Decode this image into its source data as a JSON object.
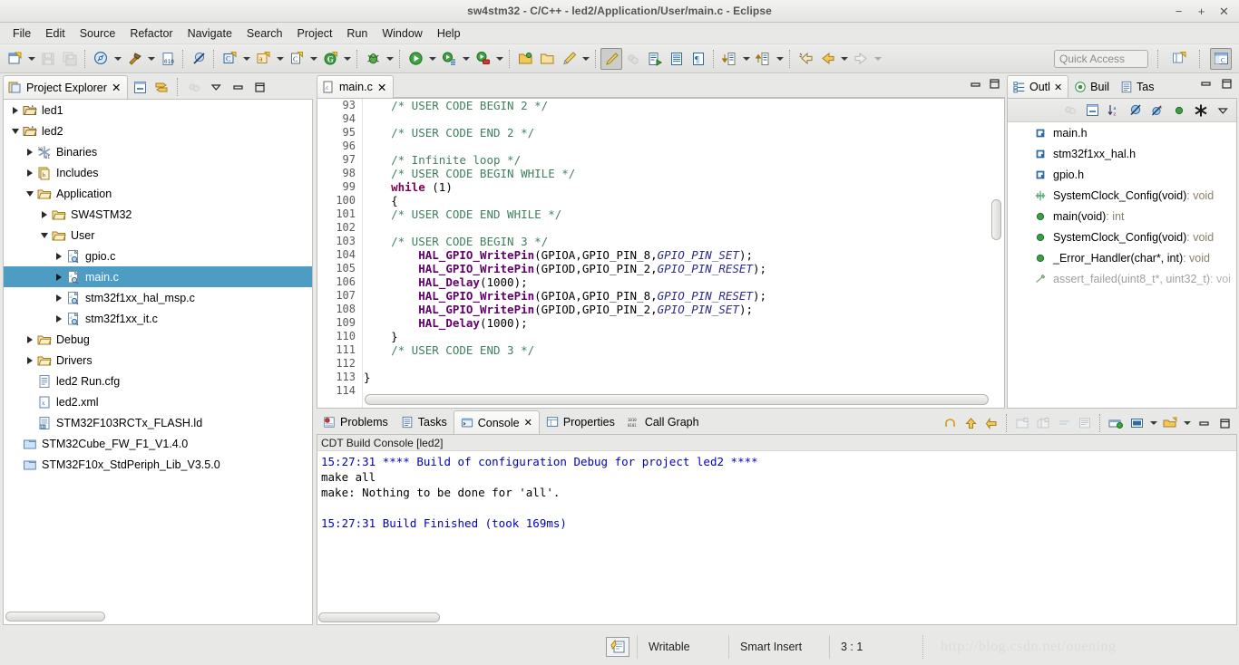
{
  "window": {
    "title": "sw4stm32 - C/C++ - led2/Application/User/main.c - Eclipse",
    "minimize": "−",
    "maximize": "+",
    "close": "✕"
  },
  "menubar": {
    "items": [
      "File",
      "Edit",
      "Source",
      "Refactor",
      "Navigate",
      "Search",
      "Project",
      "Run",
      "Window",
      "Help"
    ]
  },
  "toolbar": {
    "quick_access": "Quick Access",
    "icons": [
      "new-file-icon",
      "new-dropdown",
      "save-icon",
      "save-all-icon",
      "sep1",
      "build-all-icon",
      "build-dropdown",
      "build-hammer-icon",
      "hammer-dropdown",
      "binary-010-icon",
      "sep2",
      "no-tool-icon",
      "sep3",
      "new-c-project-icon",
      "c-dropdown",
      "new-c-class-icon",
      "class-dropdown",
      "new-c-source-icon",
      "source-dropdown",
      "git-icon",
      "git-dropdown",
      "sep4",
      "debug-icon",
      "debug-dropdown",
      "sep5",
      "run-icon",
      "run-dropdown",
      "run-config-icon",
      "runconfig-dropdown",
      "run-stop-icon",
      "stop-dropdown",
      "sep6",
      "open-resource-icon",
      "open-folder-icon",
      "highlight-pen-icon",
      "pen-dropdown",
      "sep7",
      "toggle-mark-occurrences-icon",
      "skip-breakpoints-icon",
      "next-edit-icon",
      "show-whitespace-icon",
      "pilcrow-icon",
      "sep8",
      "next-annotation-icon",
      "next-dropdown",
      "prev-annotation-icon",
      "prev-dropdown",
      "sep9",
      "last-edit-location-icon",
      "back-icon",
      "back-dropdown",
      "forward-icon",
      "forward-dropdown"
    ],
    "right_icons": [
      "new-perspective-icon",
      "cpp-perspective-icon"
    ]
  },
  "project_explorer": {
    "tab_label": "Project Explorer",
    "close_glyph": "✕",
    "toolbar_icons": [
      "collapse-all-icon",
      "link-with-editor-icon",
      "focus-on-active-task-icon",
      "view-menu-icon",
      "minimize-icon",
      "maximize-icon"
    ],
    "tree": [
      {
        "label": "led1",
        "indent": 0,
        "state": "closed",
        "icon": "project-closed-icon",
        "selected": false
      },
      {
        "label": "led2",
        "indent": 0,
        "state": "open",
        "icon": "project-open-icon",
        "selected": false
      },
      {
        "label": "Binaries",
        "indent": 1,
        "state": "closed",
        "icon": "binaries-icon",
        "selected": false
      },
      {
        "label": "Includes",
        "indent": 1,
        "state": "closed",
        "icon": "includes-icon",
        "selected": false
      },
      {
        "label": "Application",
        "indent": 1,
        "state": "open",
        "icon": "folder-icon",
        "selected": false
      },
      {
        "label": "SW4STM32",
        "indent": 2,
        "state": "closed",
        "icon": "folder-icon",
        "selected": false
      },
      {
        "label": "User",
        "indent": 2,
        "state": "open",
        "icon": "folder-icon",
        "selected": false
      },
      {
        "label": "gpio.c",
        "indent": 3,
        "state": "closed",
        "icon": "c-file-icon",
        "selected": false
      },
      {
        "label": "main.c",
        "indent": 3,
        "state": "closed",
        "icon": "c-file-icon",
        "selected": true
      },
      {
        "label": "stm32f1xx_hal_msp.c",
        "indent": 3,
        "state": "closed",
        "icon": "c-file-icon",
        "selected": false
      },
      {
        "label": "stm32f1xx_it.c",
        "indent": 3,
        "state": "closed",
        "icon": "c-file-icon",
        "selected": false
      },
      {
        "label": "Debug",
        "indent": 1,
        "state": "closed",
        "icon": "folder-icon",
        "selected": false
      },
      {
        "label": "Drivers",
        "indent": 1,
        "state": "closed",
        "icon": "folder-icon",
        "selected": false
      },
      {
        "label": "led2 Run.cfg",
        "indent": 1,
        "state": "none",
        "icon": "text-file-icon",
        "selected": false
      },
      {
        "label": "led2.xml",
        "indent": 1,
        "state": "none",
        "icon": "xml-file-icon",
        "selected": false
      },
      {
        "label": "STM32F103RCTx_FLASH.ld",
        "indent": 1,
        "state": "none",
        "icon": "linker-file-icon",
        "selected": false
      },
      {
        "label": "STM32Cube_FW_F1_V1.4.0",
        "indent": 0,
        "state": "none",
        "icon": "closed-project-icon",
        "selected": false
      },
      {
        "label": "STM32F10x_StdPeriph_Lib_V3.5.0",
        "indent": 0,
        "state": "none",
        "icon": "closed-project-icon",
        "selected": false
      }
    ]
  },
  "editor": {
    "tab_label": "main.c",
    "tab_icon": "c-source-icon",
    "close_glyph": "✕",
    "minimize_icon": "minimize-icon",
    "maximize_icon": "maximize-icon",
    "first_line": 93,
    "lines": [
      {
        "n": 93,
        "segments": [
          {
            "t": "    /* USER CODE BEGIN 2 */",
            "c": "cmt"
          }
        ]
      },
      {
        "n": 94,
        "segments": [
          {
            "t": "",
            "c": ""
          }
        ]
      },
      {
        "n": 95,
        "segments": [
          {
            "t": "    /* USER CODE END 2 */",
            "c": "cmt"
          }
        ]
      },
      {
        "n": 96,
        "segments": [
          {
            "t": "",
            "c": ""
          }
        ]
      },
      {
        "n": 97,
        "segments": [
          {
            "t": "    /* Infinite loop */",
            "c": "cmt"
          }
        ]
      },
      {
        "n": 98,
        "segments": [
          {
            "t": "    /* USER CODE BEGIN WHILE */",
            "c": "cmt"
          }
        ]
      },
      {
        "n": 99,
        "segments": [
          {
            "t": "    ",
            "c": ""
          },
          {
            "t": "while",
            "c": "kw"
          },
          {
            "t": " (1)",
            "c": ""
          }
        ]
      },
      {
        "n": 100,
        "segments": [
          {
            "t": "    {",
            "c": ""
          }
        ]
      },
      {
        "n": 101,
        "segments": [
          {
            "t": "    /* USER CODE END WHILE */",
            "c": "cmt"
          }
        ]
      },
      {
        "n": 102,
        "segments": [
          {
            "t": "",
            "c": ""
          }
        ]
      },
      {
        "n": 103,
        "segments": [
          {
            "t": "    /* USER CODE BEGIN 3 */",
            "c": "cmt"
          }
        ]
      },
      {
        "n": 104,
        "segments": [
          {
            "t": "        ",
            "c": ""
          },
          {
            "t": "HAL_GPIO_WritePin",
            "c": "fn"
          },
          {
            "t": "(GPIOA,GPIO_PIN_8,",
            "c": ""
          },
          {
            "t": "GPIO_PIN_SET",
            "c": "italic"
          },
          {
            "t": ");",
            "c": ""
          }
        ]
      },
      {
        "n": 105,
        "segments": [
          {
            "t": "        ",
            "c": ""
          },
          {
            "t": "HAL_GPIO_WritePin",
            "c": "fn"
          },
          {
            "t": "(GPIOD,GPIO_PIN_2,",
            "c": ""
          },
          {
            "t": "GPIO_PIN_RESET",
            "c": "italic"
          },
          {
            "t": ");",
            "c": ""
          }
        ]
      },
      {
        "n": 106,
        "segments": [
          {
            "t": "        ",
            "c": ""
          },
          {
            "t": "HAL_Delay",
            "c": "fn"
          },
          {
            "t": "(1000);",
            "c": ""
          }
        ]
      },
      {
        "n": 107,
        "segments": [
          {
            "t": "        ",
            "c": ""
          },
          {
            "t": "HAL_GPIO_WritePin",
            "c": "fn"
          },
          {
            "t": "(GPIOA,GPIO_PIN_8,",
            "c": ""
          },
          {
            "t": "GPIO_PIN_RESET",
            "c": "italic"
          },
          {
            "t": ");",
            "c": ""
          }
        ]
      },
      {
        "n": 108,
        "segments": [
          {
            "t": "        ",
            "c": ""
          },
          {
            "t": "HAL_GPIO_WritePin",
            "c": "fn"
          },
          {
            "t": "(GPIOD,GPIO_PIN_2,",
            "c": ""
          },
          {
            "t": "GPIO_PIN_SET",
            "c": "italic"
          },
          {
            "t": ");",
            "c": ""
          }
        ]
      },
      {
        "n": 109,
        "segments": [
          {
            "t": "        ",
            "c": ""
          },
          {
            "t": "HAL_Delay",
            "c": "fn"
          },
          {
            "t": "(1000);",
            "c": ""
          }
        ]
      },
      {
        "n": 110,
        "segments": [
          {
            "t": "    }",
            "c": ""
          }
        ]
      },
      {
        "n": 111,
        "segments": [
          {
            "t": "    /* USER CODE END 3 */",
            "c": "cmt"
          }
        ]
      },
      {
        "n": 112,
        "segments": [
          {
            "t": "",
            "c": ""
          }
        ]
      },
      {
        "n": 113,
        "segments": [
          {
            "t": "}",
            "c": ""
          }
        ]
      },
      {
        "n": 114,
        "segments": [
          {
            "t": "",
            "c": ""
          }
        ]
      }
    ]
  },
  "outline": {
    "tabs": [
      {
        "label": "Outl",
        "icon": "outline-icon",
        "active": true,
        "close_glyph": "✕"
      },
      {
        "label": "Buil",
        "icon": "build-targets-icon",
        "active": false,
        "close_glyph": ""
      },
      {
        "label": "Tas",
        "icon": "tasks-icon",
        "active": false,
        "close_glyph": ""
      }
    ],
    "window_buttons": [
      "minimize-icon",
      "maximize-icon"
    ],
    "toolbar_icons": [
      "focus-active-task-icon",
      "collapse-all-icon",
      "sort-alpha-icon",
      "hide-fields-icon",
      "hide-static-icon",
      "hide-nonpublic-icon",
      "hide-macros-icon",
      "view-menu-icon"
    ],
    "items": [
      {
        "label": "main.h",
        "ret": "",
        "icon": "include-icon",
        "faded": false
      },
      {
        "label": "stm32f1xx_hal.h",
        "ret": "",
        "icon": "include-icon",
        "faded": false
      },
      {
        "label": "gpio.h",
        "ret": "",
        "icon": "include-icon",
        "faded": false
      },
      {
        "label": "SystemClock_Config(void)",
        "ret": " : void",
        "icon": "prototype-icon",
        "faded": false
      },
      {
        "label": "main(void)",
        "ret": " : int",
        "icon": "function-icon",
        "faded": false
      },
      {
        "label": "SystemClock_Config(void)",
        "ret": " : void",
        "icon": "function-icon",
        "faded": false
      },
      {
        "label": "_Error_Handler(char*, int)",
        "ret": " : void",
        "icon": "function-icon",
        "faded": false
      },
      {
        "label": "assert_failed(uint8_t*, uint32_t)",
        "ret": " : voi",
        "icon": "inactive-function-icon",
        "faded": true
      }
    ]
  },
  "console": {
    "tabs": [
      {
        "label": "Problems",
        "icon": "problems-icon",
        "active": false,
        "close_glyph": ""
      },
      {
        "label": "Tasks",
        "icon": "tasks-icon",
        "active": false,
        "close_glyph": ""
      },
      {
        "label": "Console",
        "icon": "console-icon",
        "active": true,
        "close_glyph": "✕"
      },
      {
        "label": "Properties",
        "icon": "properties-icon",
        "active": false,
        "close_glyph": ""
      },
      {
        "label": "Call Graph",
        "icon": "call-graph-icon",
        "active": false,
        "close_glyph": ""
      }
    ],
    "toolbar_icons": [
      "terminate-icon",
      "remove-launch-icon",
      "remove-all-terminated-icon",
      "sep",
      "clear-console-icon",
      "scroll-lock-icon",
      "word-wrap-icon",
      "show-console-icon",
      "sep",
      "pin-console-icon",
      "display-selected-console-icon",
      "display-dropdown",
      "open-console-icon",
      "open-dropdown",
      "minimize-icon",
      "maximize-icon"
    ],
    "subtitle": "CDT Build Console [led2]",
    "lines": [
      {
        "text": "15:27:31 **** Build of configuration Debug for project led2 ****",
        "color": "blue"
      },
      {
        "text": "make all",
        "color": "black"
      },
      {
        "text": "make: Nothing to be done for 'all'.",
        "color": "black"
      },
      {
        "text": "",
        "color": "black"
      },
      {
        "text": "15:27:31 Build Finished (took 169ms)",
        "color": "blue"
      }
    ]
  },
  "statusbar": {
    "icon": "writable-mode-icon",
    "writable": "Writable",
    "insert_mode": "Smart Insert",
    "position": "3 : 1",
    "watermark": "http://blog.csdn.net/ouening"
  },
  "colors": {
    "selection_blue": "#4c9cc4",
    "comment_green": "#3f7f5f",
    "keyword_purple": "#7f0055",
    "function_purple": "#62006b",
    "console_blue": "#0000c0",
    "chrome_gray": "#e8e8e6"
  }
}
